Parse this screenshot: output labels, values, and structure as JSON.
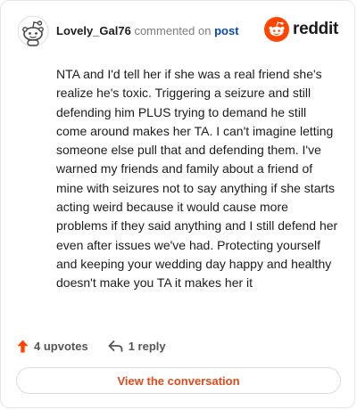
{
  "comment": {
    "author": "Lovely_Gal76",
    "action_text": "commented on",
    "post_link_label": "post",
    "body": "NTA and I'd tell her if she was a real friend she's realize he's toxic. Triggering a seizure and still defending him PLUS trying to demand he still come around makes her TA. I can't imagine letting someone else pull that and defending them. I've warned my friends and family about a friend of mine with seizures not to say anything if she starts acting weird because it would cause more problems if they said anything and I still defend her even after issues we've had. Protecting yourself and keeping your wedding day happy and healthy doesn't make you TA it makes her it"
  },
  "brand": {
    "name": "reddit",
    "icon": "reddit-logo-icon",
    "color": "#ff4500"
  },
  "actions": {
    "upvotes_label": "4 upvotes",
    "upvote_icon": "upvote-arrow-icon",
    "upvote_color": "#ff4500",
    "reply_label": "1 reply",
    "reply_icon": "reply-arrow-icon"
  },
  "footer": {
    "view_button_label": "View the conversation",
    "accent_color": "#e04a1a"
  }
}
